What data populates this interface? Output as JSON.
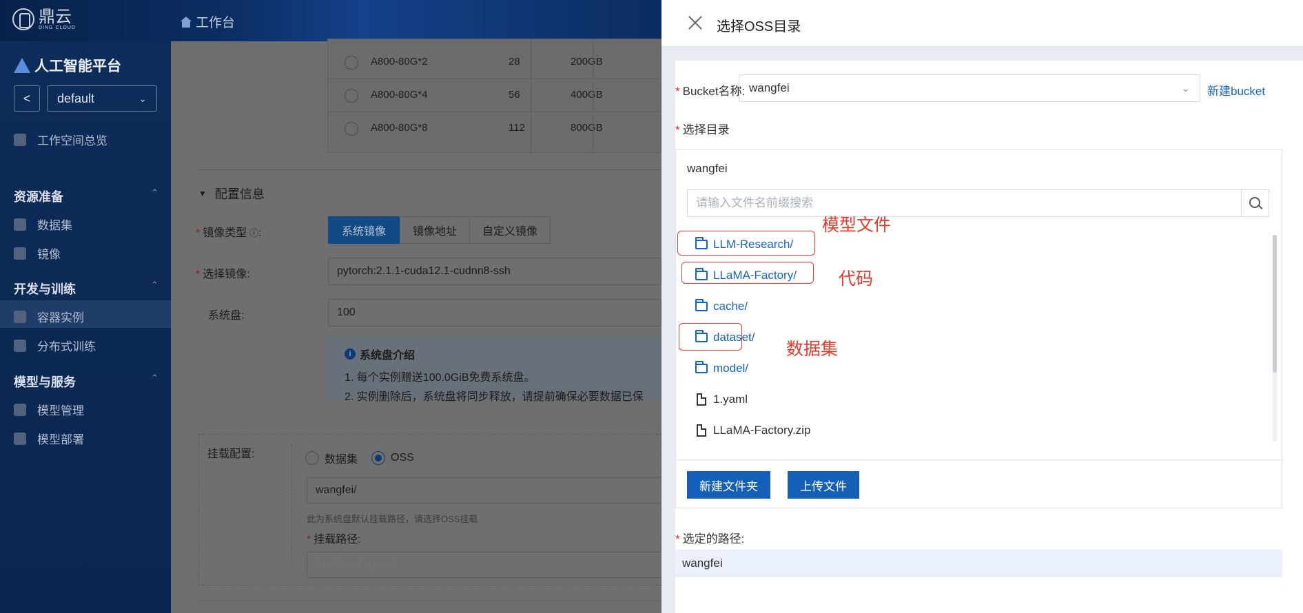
{
  "brand": {
    "cn": "鼎云",
    "en": "DING CLOUD"
  },
  "topnav": {
    "workbench": "工作台"
  },
  "sidebar": {
    "platform": "人工智能平台",
    "back": "<",
    "workspace": "default",
    "overview": "工作空间总览",
    "groups": [
      {
        "title": "资源准备",
        "items": [
          "数据集",
          "镜像"
        ]
      },
      {
        "title": "开发与训练",
        "items": [
          "容器实例",
          "分布式训练"
        ]
      },
      {
        "title": "模型与服务",
        "items": [
          "模型管理",
          "模型部署"
        ]
      }
    ]
  },
  "background": {
    "gpu_rows": [
      {
        "spec": "A800-80G*2",
        "cpu": "28",
        "mem": "200GB"
      },
      {
        "spec": "A800-80G*4",
        "cpu": "56",
        "mem": "400GB"
      },
      {
        "spec": "A800-80G*8",
        "cpu": "112",
        "mem": "800GB"
      }
    ],
    "section": "配置信息",
    "image_type_label": "镜像类型",
    "image_type_tabs": [
      "系统镜像",
      "镜像地址",
      "自定义镜像"
    ],
    "select_image_label": "选择镜像:",
    "select_image_value": "pytorch:2.1.1-cuda12.1-cudnn8-ssh",
    "sysdisk_label": "系统盘:",
    "sysdisk_value": "100",
    "info_title": "系统盘介绍",
    "info_1": "1. 每个实例赠送100.0GiB免费系统盘。",
    "info_2": "2. 实例删除后，系统盘将同步释放，请提前确保必要数据已保",
    "mount_label": "挂载配置:",
    "mount_opt1": "数据集",
    "mount_opt2": "OSS",
    "mount_value": "wangfei/",
    "mount_hint": "此为系统盘默认挂载路径，请选择OSS挂载",
    "mount_path_label": "挂载路径:",
    "mount_path_placeholder": "/mnt/workspace/"
  },
  "drawer": {
    "title": "选择OSS目录",
    "bucket_label": "Bucket名称:",
    "bucket_value": "wangfei",
    "new_bucket": "新建bucket",
    "dir_label": "选择目录",
    "root": "wangfei",
    "search_placeholder": "请输入文件名前缀搜索",
    "entries": [
      {
        "name": "LLM-Research/",
        "kind": "dir"
      },
      {
        "name": "LLaMA-Factory/",
        "kind": "dir"
      },
      {
        "name": "cache/",
        "kind": "dir"
      },
      {
        "name": "dataset/",
        "kind": "dir"
      },
      {
        "name": "model/",
        "kind": "dir"
      },
      {
        "name": "1.yaml",
        "kind": "file"
      },
      {
        "name": "LLaMA-Factory.zip",
        "kind": "file"
      }
    ],
    "annotations": [
      "模型文件",
      "代码",
      "数据集"
    ],
    "new_folder": "新建文件夹",
    "upload": "上传文件",
    "selected_label": "选定的路径:",
    "selected_value": "wangfei"
  }
}
